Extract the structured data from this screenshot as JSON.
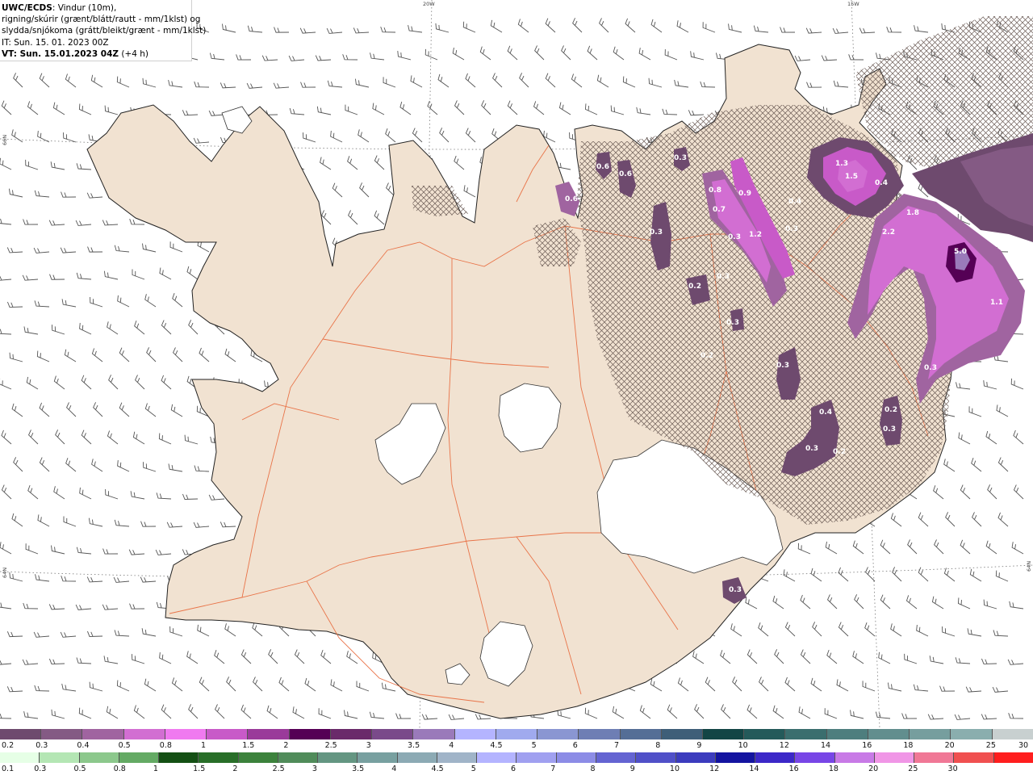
{
  "header": {
    "model": "UWC/ECDS",
    "line1_rest": ": Vindur (10m),",
    "line2": "rigning/skúrir (grænt/blátt/rautt - mm/1klst) og",
    "line3": "slydda/snjókoma (grátt/bleikt/grænt - mm/1klst)",
    "line4": "IT: Sun. 15. 01. 2023 00Z",
    "line5_bold": "VT: Sun. 15.01.2023 04Z",
    "line5_rest": " (+4 h)"
  },
  "coords": {
    "top_20w": "20W",
    "top_15w": "15W",
    "left_66n": "66N",
    "left_64n": "64N",
    "right_64n": "64N"
  },
  "colors": {
    "land": "#f1e2d1",
    "glacier": "#ffffff",
    "roads": "#e8683a",
    "coast": "#222222",
    "barb": "#555555"
  },
  "precip_labels": [
    "0.6",
    "0.6",
    "0.6",
    "0.3",
    "0.8",
    "0.9",
    "0.7",
    "0.3",
    "1.2",
    "0.4",
    "0.3",
    "1.3",
    "1.5",
    "0.4",
    "1.8",
    "2.2",
    "5.0",
    "1.1",
    "0.3",
    "0.4",
    "0.3",
    "0.2",
    "0.3",
    "0.3",
    "0.3",
    "0.2",
    "0.3",
    "0.3",
    "0.2",
    "0.3",
    "0.2"
  ],
  "legend_snow": {
    "colors": [
      "#6e4a6e",
      "#845a84",
      "#a064a0",
      "#d26ed2",
      "#f07af0",
      "#c85ac8",
      "#9a3a9a",
      "#550055",
      "#6a2a6a",
      "#7a4a8a",
      "#9a7aba",
      "#b4b4ff",
      "#a0aaee",
      "#8a96d2",
      "#6e7eb4",
      "#546e96",
      "#3e5e78",
      "#134545",
      "#245a5a",
      "#3a6e6e",
      "#4e7e7e",
      "#628e8e",
      "#769e9e",
      "#8aaeae",
      "#c8d0d0"
    ],
    "labels": [
      "0.2",
      "0.3",
      "0.4",
      "0.5",
      "0.8",
      "1",
      "1.5",
      "2",
      "2.5",
      "3",
      "3.5",
      "4",
      "4.5",
      "5",
      "6",
      "7",
      "8",
      "9",
      "10",
      "12",
      "14",
      "16",
      "18",
      "20",
      "25",
      "30"
    ]
  },
  "legend_rain": {
    "colors": [
      "#e6ffe6",
      "#b4e6b4",
      "#8cc88c",
      "#64aa64",
      "#145014",
      "#286e28",
      "#3c823c",
      "#508c5a",
      "#649682",
      "#78a0a0",
      "#8caab4",
      "#a0b4c8",
      "#b4b4ff",
      "#a0a0f0",
      "#8c8ce6",
      "#6464d2",
      "#5050c8",
      "#3c3cbe",
      "#1414a0",
      "#3c28c8",
      "#7846e6",
      "#c87ae6",
      "#f096e6",
      "#f07896",
      "#f05050",
      "#ff1e1e"
    ],
    "labels": [
      "0.1",
      "0.3",
      "0.5",
      "0.8",
      "1",
      "1.5",
      "2",
      "2.5",
      "3",
      "3.5",
      "4",
      "4.5",
      "5",
      "6",
      "7",
      "8",
      "9",
      "10",
      "12",
      "14",
      "16",
      "18",
      "20",
      "25",
      "30"
    ]
  }
}
